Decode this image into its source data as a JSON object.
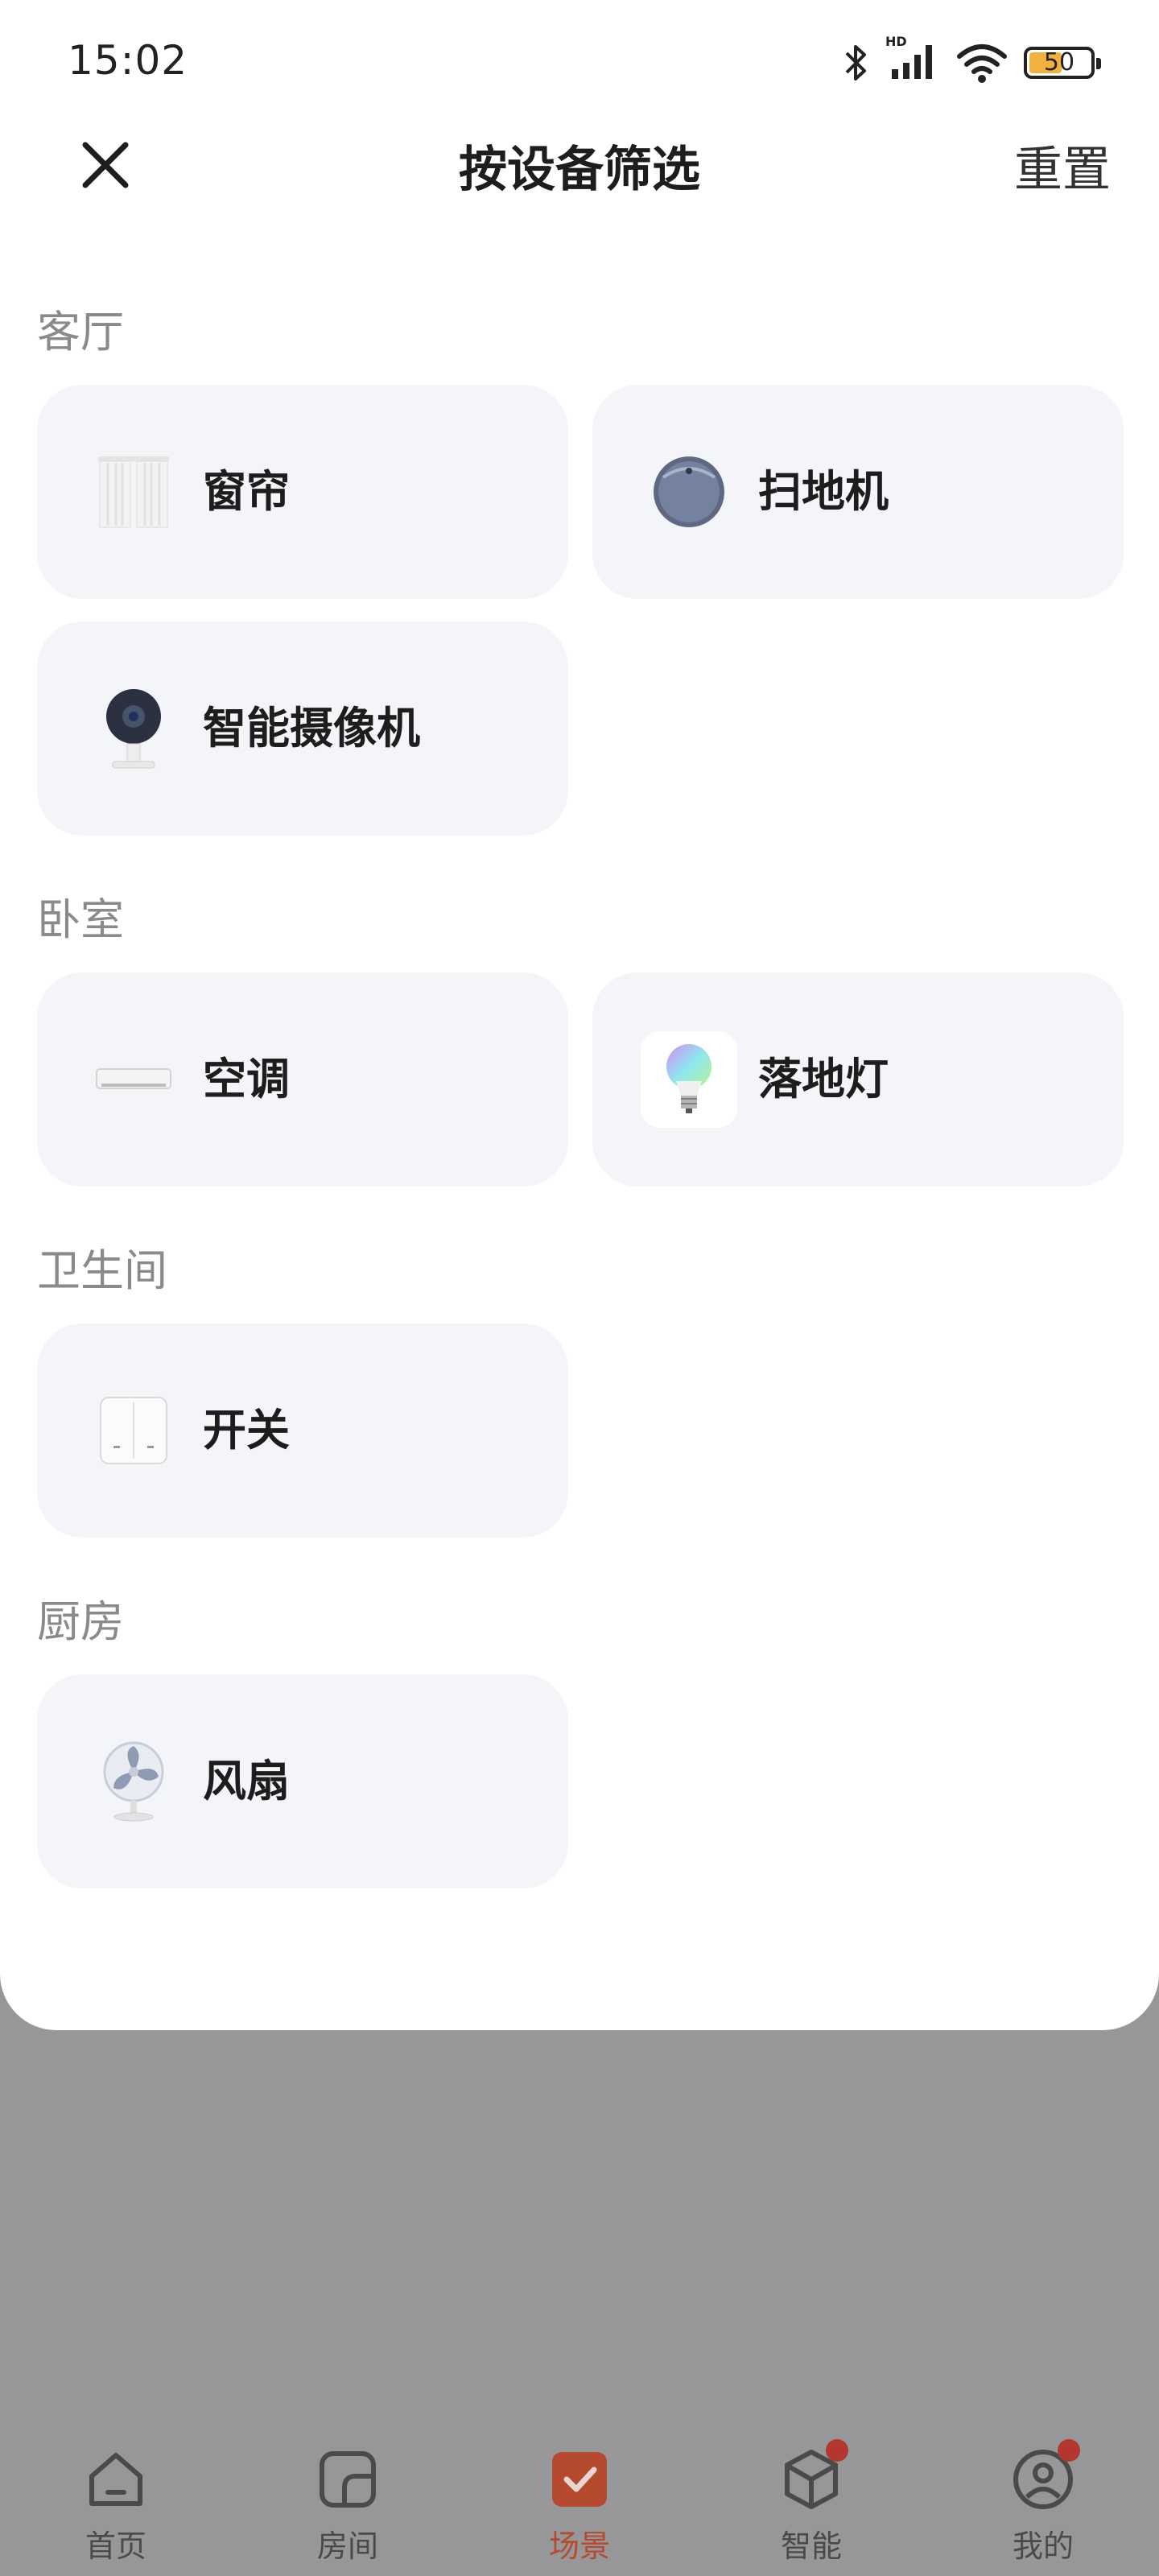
{
  "status_bar": {
    "time": "15:02",
    "battery_level": "50",
    "hd_label": "HD"
  },
  "header": {
    "title": "按设备筛选",
    "reset_label": "重置",
    "close_icon": "close-icon"
  },
  "rooms": [
    {
      "name": "客厅",
      "devices": [
        {
          "label": "窗帘",
          "icon": "curtain-icon"
        },
        {
          "label": "扫地机",
          "icon": "robot-vacuum-icon"
        },
        {
          "label": "智能摄像机",
          "icon": "camera-icon"
        }
      ]
    },
    {
      "name": "卧室",
      "devices": [
        {
          "label": "空调",
          "icon": "air-conditioner-icon"
        },
        {
          "label": "落地灯",
          "icon": "bulb-icon"
        }
      ]
    },
    {
      "name": "卫生间",
      "devices": [
        {
          "label": "开关",
          "icon": "switch-icon"
        }
      ]
    },
    {
      "name": "厨房",
      "devices": [
        {
          "label": "风扇",
          "icon": "fan-icon"
        }
      ]
    }
  ],
  "tabbar": {
    "active_color": "#b64a2f",
    "badge_color": "#b5362d",
    "tabs": [
      {
        "label": "首页",
        "icon": "home-icon"
      },
      {
        "label": "房间",
        "icon": "room-icon"
      },
      {
        "label": "场景",
        "icon": "scene-icon",
        "active": true
      },
      {
        "label": "智能",
        "icon": "smart-cube-icon",
        "badge": true
      },
      {
        "label": "我的",
        "icon": "profile-icon",
        "badge": true
      }
    ]
  }
}
